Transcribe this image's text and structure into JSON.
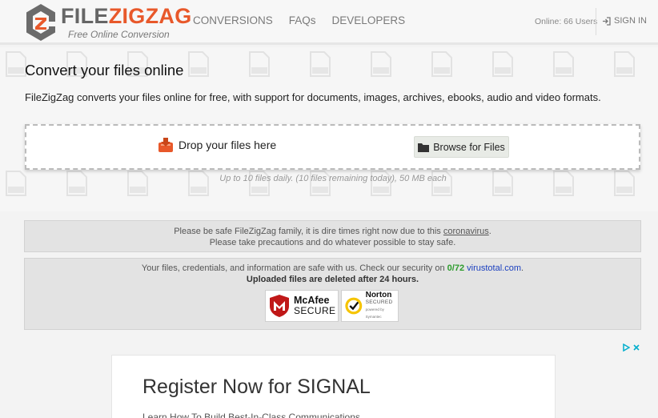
{
  "header": {
    "logo": {
      "name_part1": "FILE",
      "name_part2": "ZIGZAG",
      "tagline": "Free Online Conversion"
    },
    "nav": [
      {
        "label": "CONVERSIONS"
      },
      {
        "label": "FAQs"
      },
      {
        "label": "DEVELOPERS"
      }
    ],
    "online_users": "Online: 66 Users",
    "sign_in": "SIGN IN"
  },
  "hero": {
    "title": "Convert your files online",
    "description": "FileZigZag converts your files online for free, with support for documents, images, archives, ebooks, audio and video formats.",
    "drop_label": "Drop your files here",
    "browse_label": "Browse for Files",
    "limit_note": "Up to 10 files daily. (10 files remaining today), 50 MB each"
  },
  "notice_covid": {
    "line1_prefix": "Please be safe FileZigZag family, it is dire times right now due to this ",
    "line1_link": "coronavirus",
    "line1_suffix": ".",
    "line2": "Please take precautions and do whatever possible to stay safe."
  },
  "notice_security": {
    "line1_prefix": "Your files, credentials, and information are safe with us. Check our security on ",
    "vt_score": "0/72",
    "vt_link": "virustotal.com",
    "line1_suffix": ".",
    "line2": "Uploaded files are deleted after 24 hours.",
    "mcafee_name": "McAfee",
    "mcafee_sub": "SECURE",
    "norton_name": "Norton",
    "norton_sub": "SECURED",
    "norton_powered": "powered by Symantec"
  },
  "ad": {
    "title": "Register Now for SIGNAL",
    "subtitle": "Learn How To Build Best-In-Class Communications"
  },
  "colors": {
    "brand_orange": "#e8582a",
    "nav_gray": "#7a7a7a",
    "virustotal_green": "#2d9c2d",
    "virustotal_blue": "#1a3fbf",
    "ad_choices_blue": "#00aecd"
  }
}
